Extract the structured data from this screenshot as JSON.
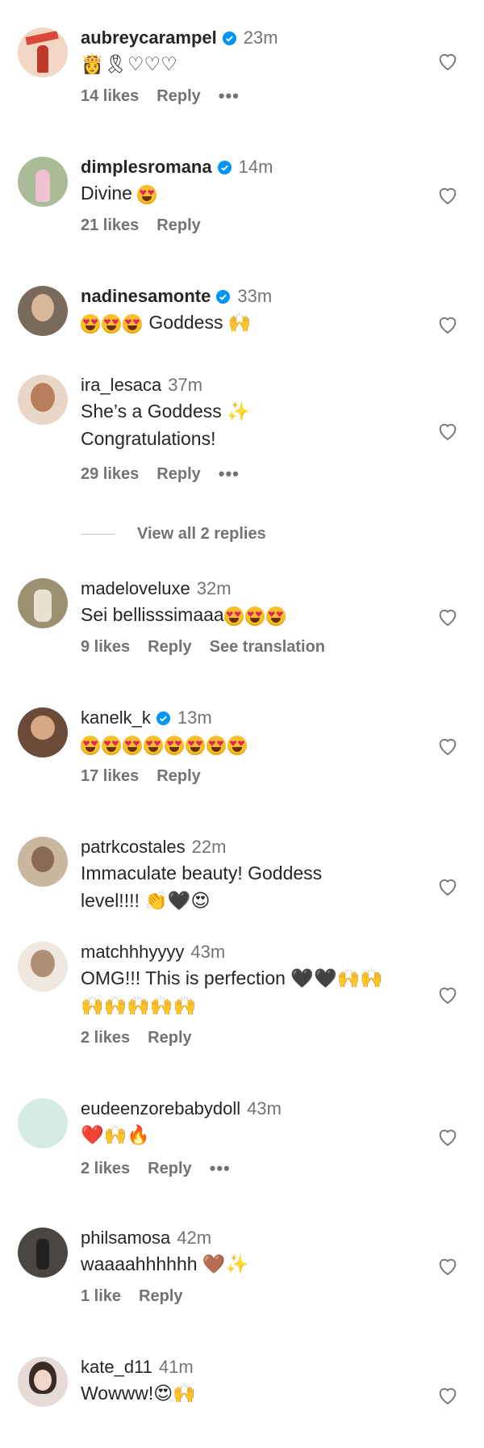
{
  "comments": [
    {
      "username": "aubreycarampel",
      "verified": true,
      "time": "23m",
      "text": "",
      "emojis": "👸🎗♡♡♡",
      "likes": "14 likes",
      "reply": "Reply",
      "extra": "",
      "dots": true,
      "avatar": "#d94a3d"
    },
    {
      "username": "dimplesromana",
      "verified": true,
      "time": "14m",
      "text": "Divine",
      "emojis": "😍",
      "likes": "21 likes",
      "reply": "Reply",
      "extra": "",
      "dots": false,
      "avatar": "#9cae8a"
    },
    {
      "username": "nadinesamonte",
      "verified": true,
      "time": "33m",
      "text": "Goddess",
      "emojis": "😍😍😍 🙌",
      "likes": "",
      "reply": "",
      "extra": "",
      "dots": false,
      "avatar": "#6a5a4e"
    },
    {
      "username": "ira_lesaca",
      "verified": false,
      "time": "37m",
      "text": "She’s a Goddess ✨",
      "text2": "Congratulations!",
      "emojis": "",
      "likes": "29 likes",
      "reply": "Reply",
      "extra": "",
      "dots": true,
      "avatar": "#c99a7a"
    },
    {
      "username": "madeloveluxe",
      "verified": false,
      "time": "32m",
      "text": "Sei bellisssimaaa",
      "emojis": "😍😍😍",
      "likes": "9 likes",
      "reply": "Reply",
      "extra": "See translation",
      "dots": false,
      "avatar": "#8a8066"
    },
    {
      "username": "kanelk_k",
      "verified": true,
      "time": "13m",
      "text": "",
      "emojis": "😍😍😍😍😍😍😍😍",
      "likes": "17 likes",
      "reply": "Reply",
      "extra": "",
      "dots": false,
      "avatar": "#7b5a46"
    },
    {
      "username": "patrkcostales",
      "verified": false,
      "time": "22m",
      "text": "Immaculate beauty! Goddess",
      "text2": "level!!!! 👏🖤😍",
      "emojis": "",
      "likes": "",
      "reply": "",
      "extra": "",
      "dots": false,
      "avatar": "#b8a48c"
    },
    {
      "username": "matchhhyyyy",
      "verified": false,
      "time": "43m",
      "text": "OMG!!! This is perfection 🖤🖤🙌🙌",
      "text2": "🙌🙌🙌🙌🙌",
      "emojis": "",
      "likes": "2 likes",
      "reply": "Reply",
      "extra": "",
      "dots": false,
      "avatar": "#e6ddd4"
    },
    {
      "username": "eudeenzorebabydoll",
      "verified": false,
      "time": "43m",
      "text": "",
      "emojis": "❤️🙌🔥",
      "likes": "2 likes",
      "reply": "Reply",
      "extra": "",
      "dots": true,
      "avatar": "#cfe3d9"
    },
    {
      "username": "philsamosa",
      "verified": false,
      "time": "42m",
      "text": "waaaahhhhhh 🤎✨",
      "emojis": "",
      "likes": "1 like",
      "reply": "Reply",
      "extra": "",
      "dots": false,
      "avatar": "#3d3b38"
    },
    {
      "username": "kate_d11",
      "verified": false,
      "time": "41m",
      "text": "Wowww!😍🙌",
      "emojis": "",
      "likes": "",
      "reply": "",
      "extra": "",
      "dots": false,
      "avatar": "#d8c9c4"
    }
  ],
  "view_replies": "View all 2 replies",
  "colors": {
    "verified": "#0095f6",
    "secondary": "#737373",
    "primary": "#262626"
  }
}
